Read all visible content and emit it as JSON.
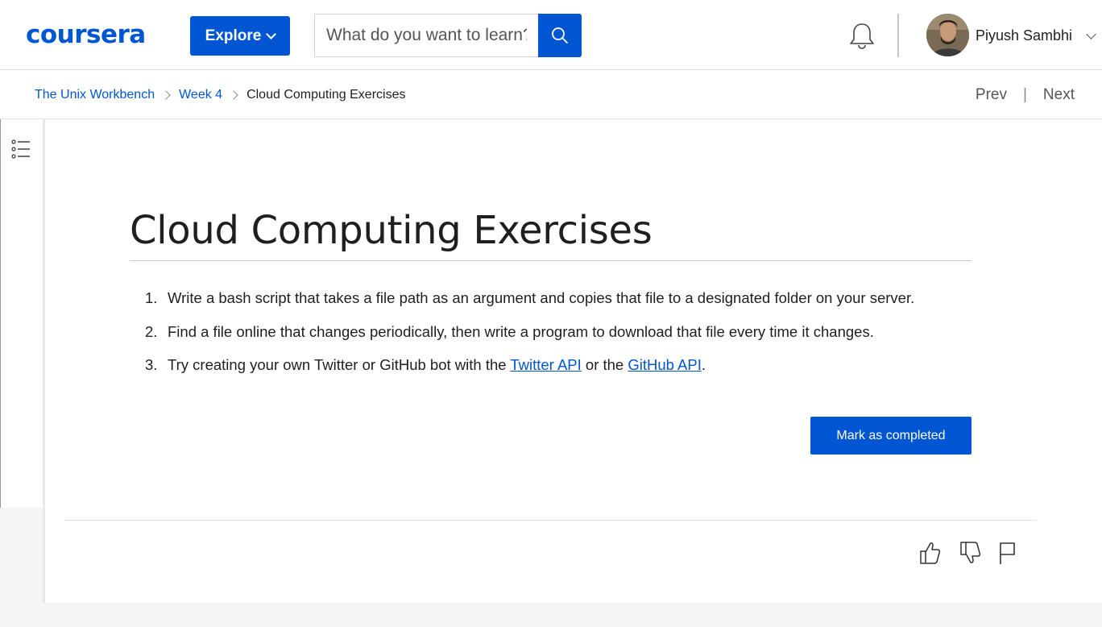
{
  "header": {
    "logo_text": "coursera",
    "explore_label": "Explore",
    "search_placeholder": "What do you want to learn?",
    "user_name": "Piyush Sambhi",
    "accent_color": "#0056d2",
    "icons": [
      "search-icon",
      "bell-icon",
      "chevron-down-icon"
    ]
  },
  "breadcrumb": {
    "items": [
      "The Unix Workbench",
      "Week 4",
      "Cloud Computing Exercises"
    ],
    "prev_label": "Prev",
    "next_label": "Next"
  },
  "sidebar": {
    "icon": "table-of-contents-icon"
  },
  "main": {
    "title": "Cloud Computing Exercises",
    "exercises": [
      {
        "num": "1.",
        "text": "Write a bash script that takes a file path as an argument and copies that file to a designated folder on your server."
      },
      {
        "num": "2.",
        "text": "Find a file online that changes periodically, then write a program to download that file every time it changes."
      },
      {
        "num": "3.",
        "text_before": "Try creating your own Twitter or GitHub bot with the ",
        "link1": "Twitter API",
        "text_mid": " or the ",
        "link2": "GitHub API",
        "text_after": "."
      }
    ],
    "complete_label": "Mark as completed",
    "feedback_icons": [
      "thumbs-up-icon",
      "thumbs-down-icon",
      "flag-icon"
    ]
  }
}
